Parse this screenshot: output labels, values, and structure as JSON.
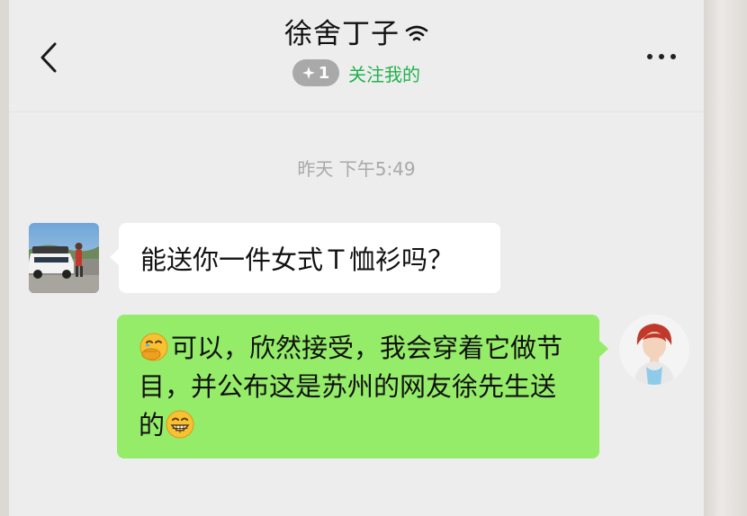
{
  "header": {
    "contact_name": "徐舍丁子",
    "badge_text": "1",
    "follow_text": "关注我的"
  },
  "chat": {
    "timestamp": "昨天 下午5:49",
    "messages": [
      {
        "from": "contact",
        "text": "能送你一件女式Ｔ恤衫吗？"
      },
      {
        "from": "me",
        "emoji_start": "face-with-hand-over-mouth",
        "text": "可以，欣然接受，我会穿着它做节目，并公布这是苏州的网友徐先生送的",
        "emoji_end": "grinning-face"
      }
    ]
  },
  "colors": {
    "outgoing_bubble": "#95ec69",
    "incoming_bubble": "#ffffff",
    "follow_green": "#22b14c",
    "background": "#ededed"
  },
  "icons": [
    "back-arrow-icon",
    "wifi-icon",
    "sparkle-icon",
    "more-dots-icon",
    "face-with-hand-over-mouth-emoji",
    "grinning-face-emoji"
  ]
}
